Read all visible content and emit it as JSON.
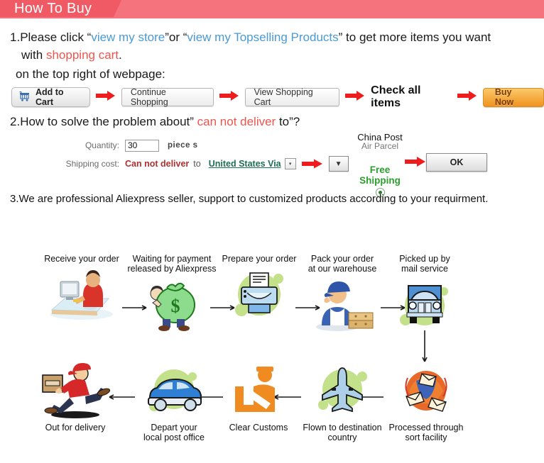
{
  "banner": {
    "title": "How To Buy",
    "bar_color": "#f4737c",
    "tab_color": "#ef5a64"
  },
  "step1": {
    "number": "1.",
    "text_a": "Please click “",
    "link_store": "view my store",
    "text_b": "”or “",
    "link_top": "view my Topselling Products",
    "text_c": "” to get  more items you want",
    "line2_a": "with ",
    "line2_highlight": "shopping cart",
    "line2_b": ".",
    "subline": "on the top right of webpage:"
  },
  "buttons": {
    "add_to_cart": "Add to Cart",
    "cart_icon": "shopping-cart-icon",
    "continue_shopping": "Continue Shopping",
    "view_shopping_cart": "View Shopping Cart",
    "check_all_items": "Check all items",
    "buy_now": "Buy Now",
    "arrow_icon": "right-arrow-icon",
    "buy_now_color": "#f0921e"
  },
  "step2": {
    "number": "2.",
    "text_a": "How to solve the problem about” ",
    "highlight": "can not deliver",
    "text_b": " to”?",
    "quantity_label": "Quantity:",
    "quantity_value": "30",
    "quantity_unit": "piece s",
    "shipping_label": "Shipping cost:",
    "shipping_status": "Can not deliver",
    "shipping_to": "to",
    "country_value": "United States Via",
    "select_caret": "▾",
    "dropdown_caret": "▼",
    "carrier_line1": "China Post",
    "carrier_line2": "Air Parcel",
    "free_shipping": "Free\nShipping",
    "radio_name": "free-shipping-radio",
    "ok_button": "OK"
  },
  "step3": {
    "number": "3.",
    "text": "We are professional Aliexpress seller, support to customized products according to your requirment."
  },
  "flow": {
    "row1": [
      {
        "label": "Receive your order",
        "icon": "person-at-computer-icon"
      },
      {
        "label": "Waiting for payment\nreleased by Aliexpress",
        "icon": "money-bag-icon"
      },
      {
        "label": "Prepare your order",
        "icon": "printer-icon"
      },
      {
        "label": "Pack your order\nat our warehouse",
        "icon": "worker-with-boxes-icon"
      },
      {
        "label": "Picked up by\nmail service",
        "icon": "mail-truck-icon"
      }
    ],
    "row2": [
      {
        "label": "Out for delivery",
        "icon": "delivery-man-running-icon"
      },
      {
        "label": "Depart your\nlocal post office",
        "icon": "blue-van-icon"
      },
      {
        "label": "Clear Customs",
        "icon": "customs-officer-icon"
      },
      {
        "label": "Flown to destination\ncountry",
        "icon": "airplane-icon"
      },
      {
        "label": "Processed through\nsort facility",
        "icon": "mail-sorting-icon"
      }
    ]
  }
}
